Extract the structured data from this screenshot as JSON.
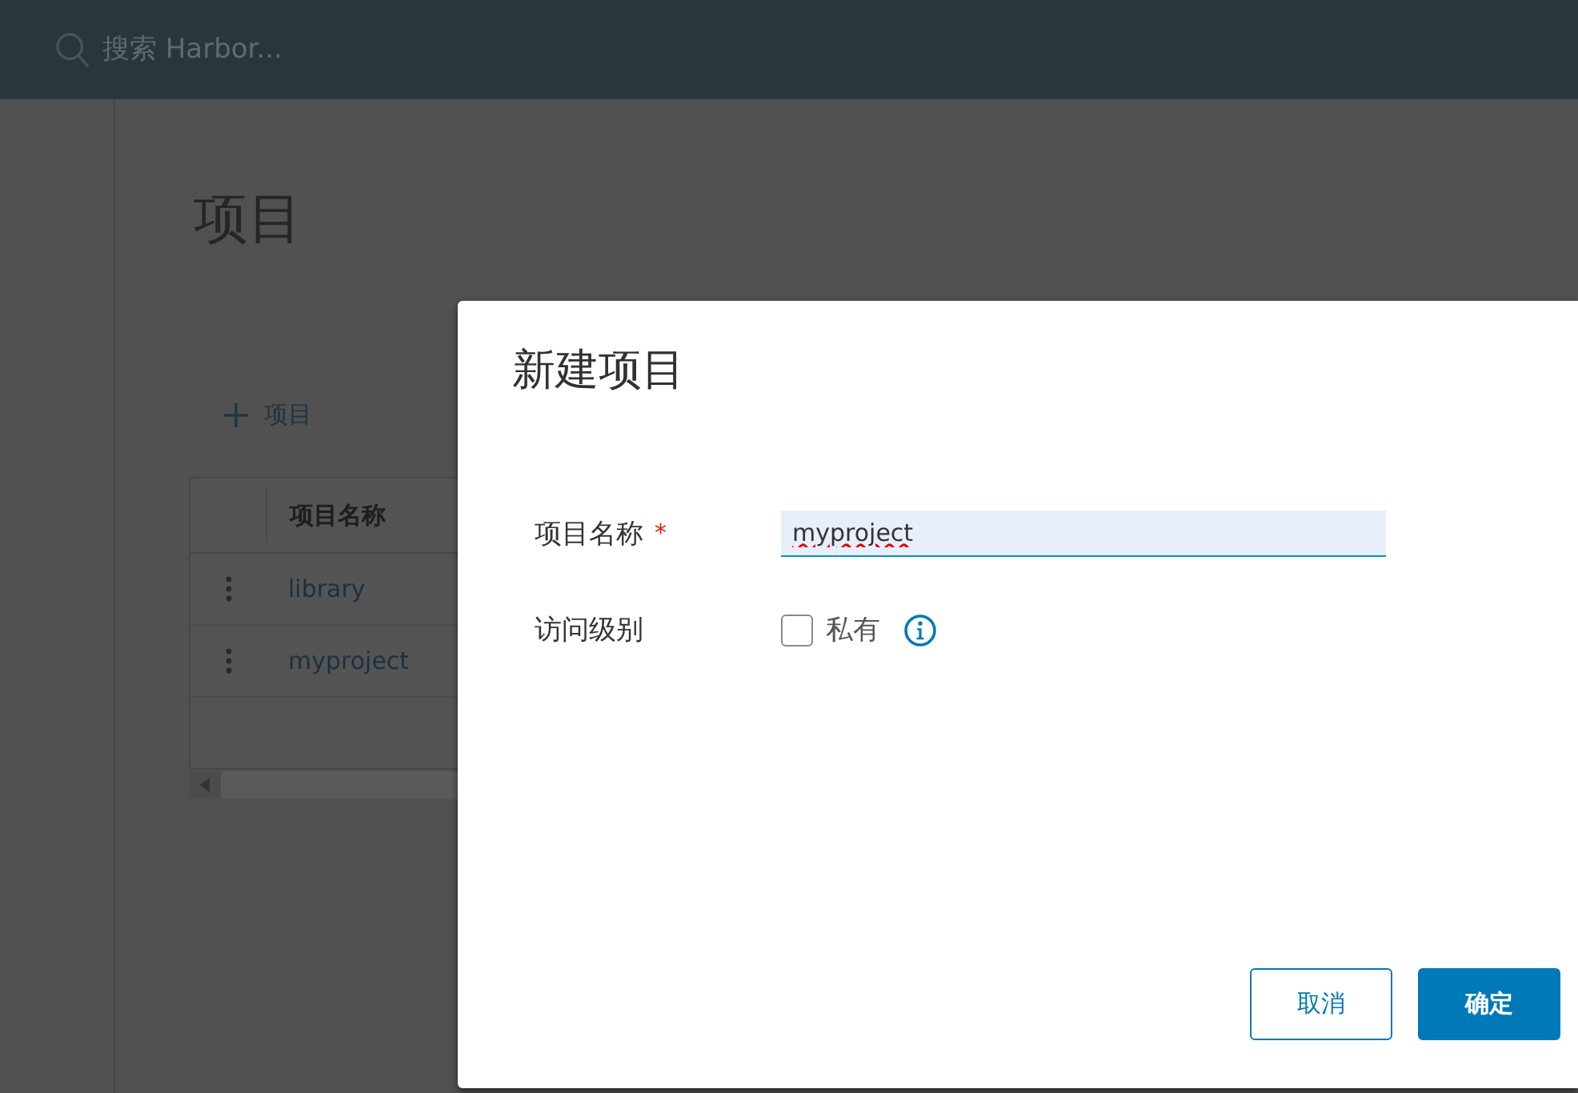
{
  "header": {
    "search": {
      "placeholder": "搜索 Harbor..."
    }
  },
  "page": {
    "title": "项目",
    "new_button": {
      "label": "项目"
    },
    "table": {
      "columns": [
        "项目名称"
      ],
      "rows": [
        {
          "name": "library"
        },
        {
          "name": "myproject"
        }
      ]
    }
  },
  "dialog": {
    "title": "新建项目",
    "fields": [
      {
        "kind": "text",
        "label": "项目名称",
        "required_mark": "*",
        "value": "myproject"
      },
      {
        "kind": "checkbox",
        "label": "访问级别",
        "option": "私有",
        "checked": false,
        "info": true
      }
    ],
    "buttons": [
      {
        "label": "取消",
        "kind": "secondary"
      },
      {
        "label": "确定",
        "kind": "primary"
      }
    ]
  }
}
